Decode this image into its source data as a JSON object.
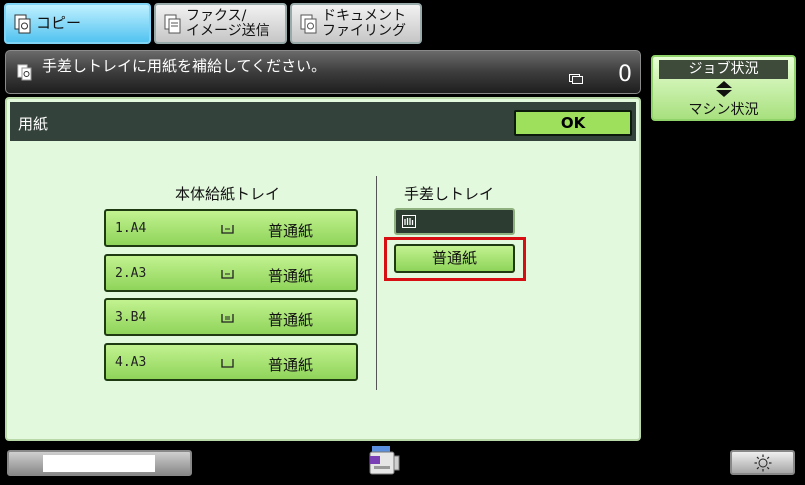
{
  "tabs": [
    {
      "label": "コピー",
      "icon": "copy-icon",
      "active": true
    },
    {
      "label_line1": "ファクス/",
      "label_line2": "イメージ送信",
      "icon": "fax-send-icon",
      "active": false
    },
    {
      "label_line1": "ドキュメント",
      "label_line2": "ファイリング",
      "icon": "document-filing-icon",
      "active": false
    }
  ],
  "message_bar": {
    "message": "手差しトレイに用紙を補給してください。",
    "copy_count": "0"
  },
  "job_status": {
    "label_top": "ジョブ状況",
    "label_bottom": "マシン状況"
  },
  "dialog": {
    "title": "用紙",
    "ok_label": "OK",
    "main_section_label": "本体給紙トレイ",
    "manual_section_label": "手差しトレイ",
    "trays": [
      {
        "number": "1.A4",
        "paper_type": "普通紙",
        "icon": "tray-landscape-icon"
      },
      {
        "number": "2.A3",
        "paper_type": "普通紙",
        "icon": "tray-landscape-icon"
      },
      {
        "number": "3.B4",
        "paper_type": "普通紙",
        "icon": "tray-landscape-icon"
      },
      {
        "number": "4.A3",
        "paper_type": "普通紙",
        "icon": "tray-empty-icon"
      }
    ],
    "manual_tray": {
      "paper_type": "普通紙",
      "icon": "bypass-tray-icon",
      "highlighted": true
    }
  },
  "bottom_bar": {
    "device_icon": "machine-status-icon",
    "brightness_icon": "brightness-icon"
  },
  "colors": {
    "accent_green": "#9ee05c",
    "active_tab_blue": "#52c3f0",
    "highlight_red": "#d80f12",
    "panel_bg": "#e3f9de",
    "header_dark": "#33423a"
  }
}
